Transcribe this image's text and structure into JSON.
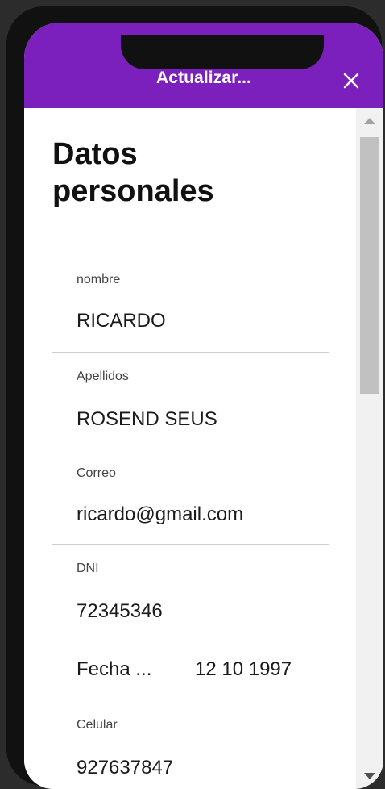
{
  "header": {
    "title": "Actualizar..."
  },
  "page": {
    "title_line1": "Datos",
    "title_line2": "personales"
  },
  "fields": [
    {
      "label": "nombre",
      "value": "RICARDO"
    },
    {
      "label": "Apellidos",
      "value": "ROSEND SEUS"
    },
    {
      "label": "Correo",
      "value": "ricardo@gmail.com"
    },
    {
      "label": "DNI",
      "value": "72345346"
    }
  ],
  "birth_date": {
    "label": "Fecha ...",
    "value": "12 10 1997"
  },
  "phone": {
    "label": "Celular",
    "value": "927637847"
  },
  "colors": {
    "accent": "#7b20bc",
    "background": "#ffffff"
  },
  "icons": {
    "close": "close-icon"
  }
}
